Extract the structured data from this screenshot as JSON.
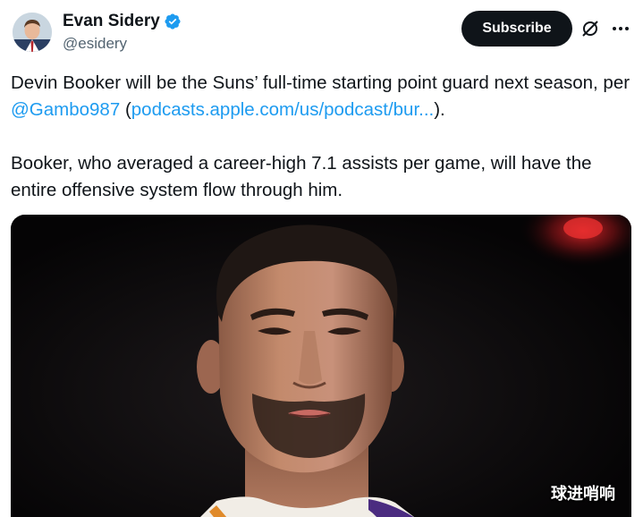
{
  "author": {
    "display_name": "Evan Sidery",
    "handle": "@esidery",
    "verified": true,
    "verified_color": "#1d9bf0"
  },
  "header": {
    "subscribe_label": "Subscribe",
    "grok_icon": "grok-icon",
    "more_icon": "more-options-icon"
  },
  "tweet": {
    "p1_text_a": "Devin Booker will be the Suns’ full-time starting point guard next season, per ",
    "p1_mention": "@Gambo987",
    "p1_open_paren": " (",
    "p1_link": "podcasts.apple.com/us/podcast/bur...",
    "p1_close": ").",
    "p2_text": "Booker, who averaged a career-high 7.1 assists per game, will have the entire offensive system flow through him."
  },
  "media": {
    "description_icon": "player-photo",
    "watermark": "球进哨响"
  },
  "colors": {
    "text": "#0f1419",
    "secondary": "#536471",
    "link": "#1d9bf0",
    "button_bg": "#0f1419"
  }
}
